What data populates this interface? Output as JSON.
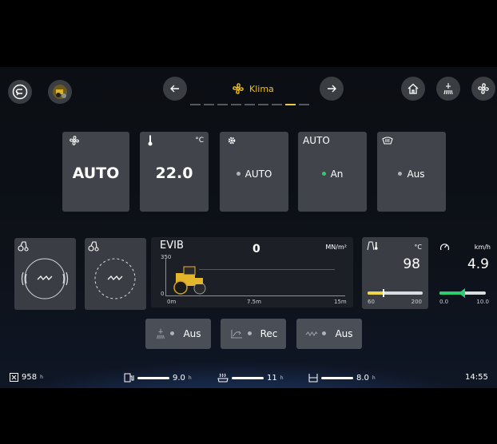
{
  "header": {
    "title": "Klima",
    "page_dots": 9,
    "active_dot": 7
  },
  "tiles": {
    "fan": {
      "value": "AUTO"
    },
    "temperature": {
      "value": "22.0",
      "unit": "°C"
    },
    "blower": {
      "status": "AUTO"
    },
    "ac": {
      "label": "AUTO",
      "status": "An"
    },
    "defrost": {
      "status": "Aus"
    }
  },
  "evib": {
    "label": "EVIB",
    "value": "0",
    "unit": "MN/m²",
    "y_max": "350",
    "y_min": "0",
    "x_start": "0m",
    "x_mid": "7.5m",
    "x_end": "15m"
  },
  "temp_gauge": {
    "unit": "°C",
    "value": "98",
    "min": "60",
    "max": "200",
    "level": 0.27
  },
  "speed_gauge": {
    "unit": "km/h",
    "value": "4.9",
    "min": "0.0",
    "max": "10.0",
    "level": 0.49
  },
  "bottom_buttons": {
    "sprinkler": "Aus",
    "recirculation": "Rec",
    "vibration": "Aus"
  },
  "statusbar": {
    "hours": "958",
    "hours_unit": "h",
    "fuel": "9.0",
    "fuel_unit": "h",
    "water": "11",
    "water_unit": "h",
    "tank": "8.0",
    "tank_unit": "h",
    "time": "14:55"
  },
  "colors": {
    "accent": "#f0c020",
    "green": "#2ecc71",
    "tile": "#41454b"
  }
}
